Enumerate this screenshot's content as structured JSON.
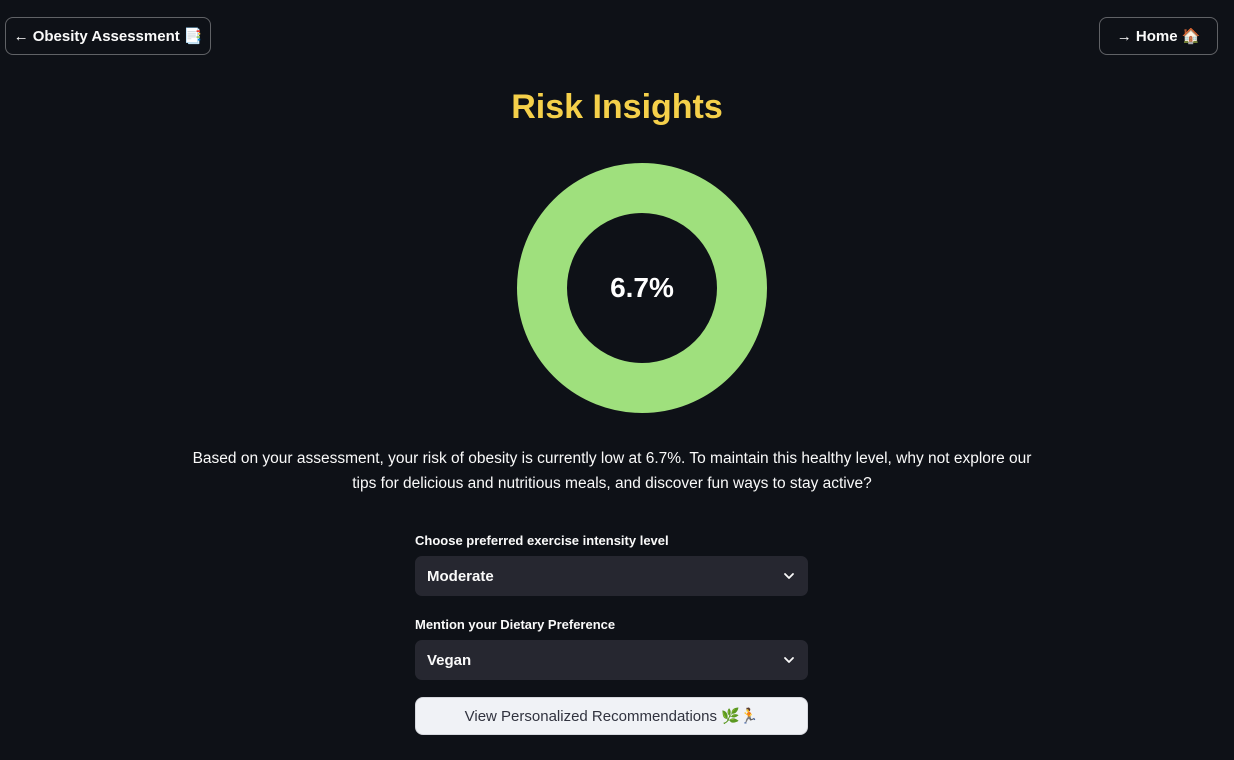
{
  "nav": {
    "back_label": "← Obesity Assessment",
    "back_icon": "📑",
    "home_label": "→ Home",
    "home_icon": "🏠"
  },
  "page_title": "Risk Insights",
  "risk": {
    "value_label": "6.7%",
    "ring_color": "#9fe07d"
  },
  "description": "Based on your assessment, your risk of obesity is currently low at 6.7%. To maintain this healthy level, why not explore our tips for delicious and nutritious meals, and discover fun ways to stay active?",
  "exercise": {
    "label": "Choose preferred exercise intensity level",
    "selected": "Moderate"
  },
  "diet": {
    "label": "Mention your Dietary Preference",
    "selected": "Vegan"
  },
  "recommend_button": {
    "label": "View Personalized Recommendations",
    "icons": "🌿🏃"
  },
  "colors": {
    "background": "#0e1117",
    "title": "#f5d04a",
    "select_bg": "#262730",
    "button_bg": "#f0f2f6"
  }
}
